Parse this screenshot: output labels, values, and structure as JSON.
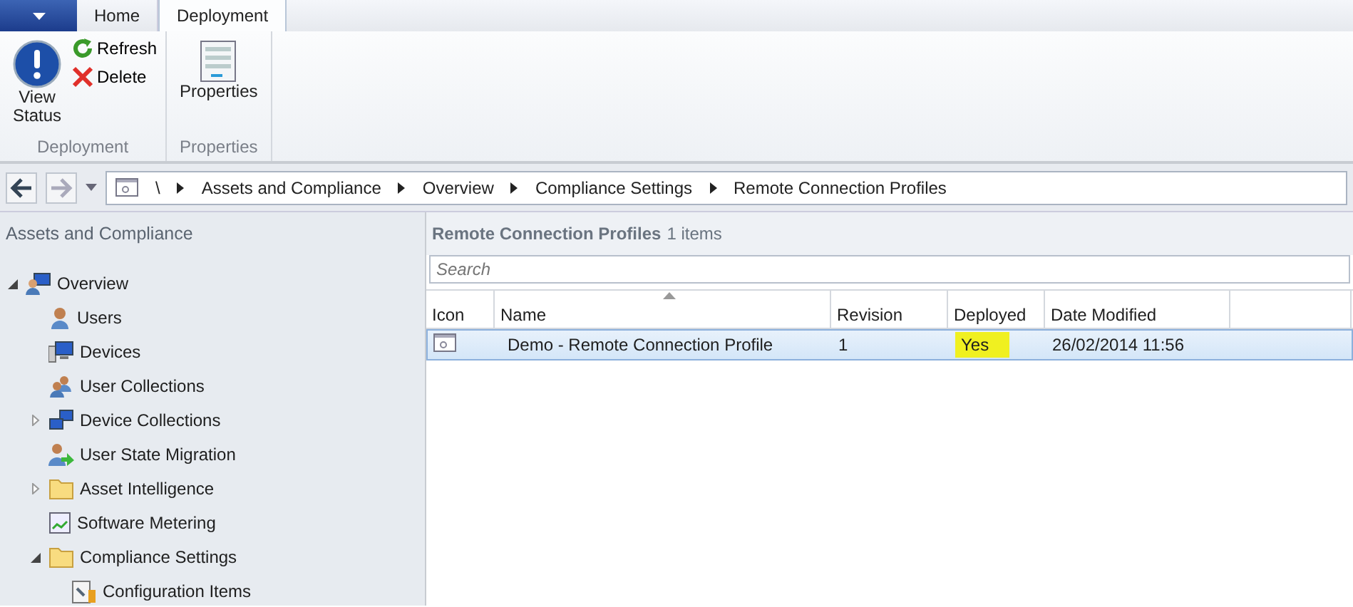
{
  "ribbon": {
    "tabs": [
      {
        "label": "Home",
        "selected": false
      },
      {
        "label": "Deployment",
        "selected": true
      }
    ],
    "groups": [
      {
        "label": "Deployment",
        "buttons": [
          {
            "kind": "info",
            "label": "View Status"
          },
          {
            "kind": "refresh",
            "label": "Refresh"
          },
          {
            "kind": "delete",
            "label": "Delete"
          }
        ]
      },
      {
        "label": "Properties",
        "buttons": [
          {
            "kind": "properties",
            "label": "Properties"
          }
        ]
      }
    ]
  },
  "nav": {
    "root": "\\",
    "crumbs": [
      "Assets and Compliance",
      "Overview",
      "Compliance Settings",
      "Remote Connection Profiles"
    ]
  },
  "sidebar": {
    "title": "Assets and Compliance",
    "items": [
      {
        "label": "Overview",
        "kind": "overview",
        "expanded": true,
        "children": [
          {
            "label": "Users",
            "kind": "user"
          },
          {
            "label": "Devices",
            "kind": "device"
          },
          {
            "label": "User Collections",
            "kind": "users"
          },
          {
            "label": "Device Collections",
            "kind": "devices",
            "expanded": false
          },
          {
            "label": "User State Migration",
            "kind": "migration"
          },
          {
            "label": "Asset Intelligence",
            "kind": "folder",
            "expanded": false
          },
          {
            "label": "Software Metering",
            "kind": "metering"
          },
          {
            "label": "Compliance Settings",
            "kind": "folder",
            "expanded": true,
            "children": [
              {
                "label": "Configuration Items",
                "kind": "config"
              }
            ]
          }
        ]
      }
    ]
  },
  "list": {
    "title": "Remote Connection Profiles",
    "count": "1 items",
    "search": {
      "placeholder": "Search"
    },
    "columns": [
      {
        "label": "Icon",
        "sorted": false
      },
      {
        "label": "Name",
        "sorted": true
      },
      {
        "label": "Revision",
        "sorted": false
      },
      {
        "label": "Deployed",
        "sorted": false
      },
      {
        "label": "Date Modified",
        "sorted": false
      }
    ],
    "rows": [
      {
        "selected": true,
        "name": "Demo - Remote Connection Profile",
        "revision": "1",
        "deployed": "Yes",
        "deployed_highlighted": true,
        "date_modified": "26/02/2014 11:56"
      }
    ]
  }
}
